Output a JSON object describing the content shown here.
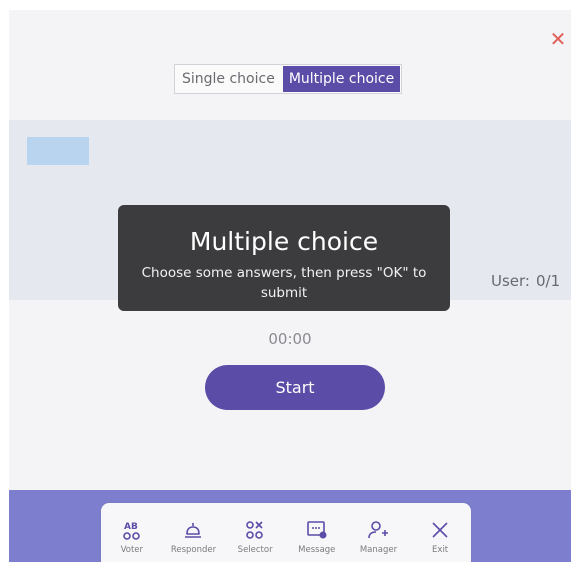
{
  "close_icon": "close-icon",
  "modes": [
    {
      "label": "Single choice",
      "active": false
    },
    {
      "label": "Multiple choice",
      "active": true
    }
  ],
  "user_count": {
    "label": "User:",
    "value": "0/1"
  },
  "tip": {
    "title": "Multiple choice",
    "text": "Choose some answers, then press \"OK\" to submit"
  },
  "timer": "00:00",
  "start_label": "Start",
  "toolbar": [
    {
      "label": "Voter",
      "icon": "voter-icon"
    },
    {
      "label": "Responder",
      "icon": "responder-icon"
    },
    {
      "label": "Selector",
      "icon": "selector-icon"
    },
    {
      "label": "Message",
      "icon": "message-icon"
    },
    {
      "label": "Manager",
      "icon": "manager-icon"
    },
    {
      "label": "Exit",
      "icon": "exit-icon"
    }
  ],
  "colors": {
    "accent": "#5b4ca8",
    "bottom_bar": "#7d7fce",
    "close": "#e0605a",
    "tip_background": "#3c3c3e"
  }
}
